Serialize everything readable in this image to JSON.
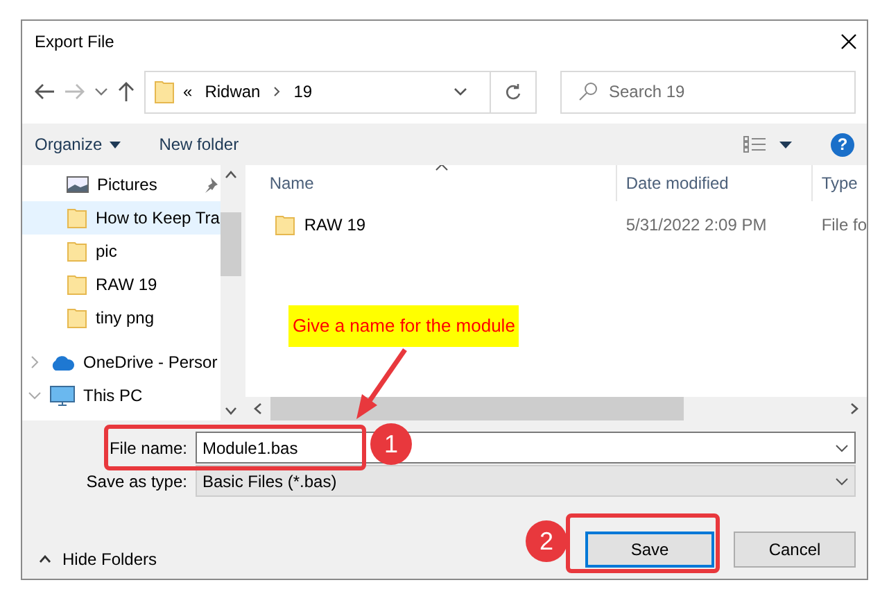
{
  "window": {
    "title": "Export File"
  },
  "address": {
    "overflow": "«",
    "segments": [
      "Ridwan",
      "19"
    ]
  },
  "search": {
    "placeholder": "Search 19"
  },
  "toolbar": {
    "organize": "Organize",
    "new_folder": "New folder",
    "help": "?"
  },
  "nav_pane": [
    {
      "label": "Pictures",
      "kind": "pictures",
      "pinned": true,
      "selected": false
    },
    {
      "label": "How to Keep Tra",
      "kind": "folder",
      "pinned": false,
      "selected": true
    },
    {
      "label": "pic",
      "kind": "folder",
      "pinned": false,
      "selected": false
    },
    {
      "label": "RAW 19",
      "kind": "folder",
      "pinned": false,
      "selected": false
    },
    {
      "label": "tiny png",
      "kind": "folder",
      "pinned": false,
      "selected": false
    },
    {
      "label": "OneDrive - Persor",
      "kind": "cloud",
      "pinned": false,
      "selected": false,
      "expanded": false
    },
    {
      "label": "This PC",
      "kind": "pc",
      "pinned": false,
      "selected": false,
      "expanded": true
    }
  ],
  "columns": [
    {
      "label": "Name",
      "sorted": true
    },
    {
      "label": "Date modified",
      "sorted": false
    },
    {
      "label": "Type",
      "sorted": false
    }
  ],
  "files": [
    {
      "name": "RAW 19",
      "date": "5/31/2022 2:09 PM",
      "type": "File fo"
    }
  ],
  "file_name": {
    "label": "File name:",
    "value": "Module1.bas"
  },
  "save_as_type": {
    "label": "Save as type:",
    "value": "Basic Files (*.bas)"
  },
  "hide_folders": "Hide Folders",
  "buttons": [
    {
      "label": "Save",
      "default": true
    },
    {
      "label": "Cancel",
      "default": false
    }
  ],
  "annotations": {
    "callout": "Give a name for the module",
    "steps": [
      "1",
      "2"
    ]
  }
}
